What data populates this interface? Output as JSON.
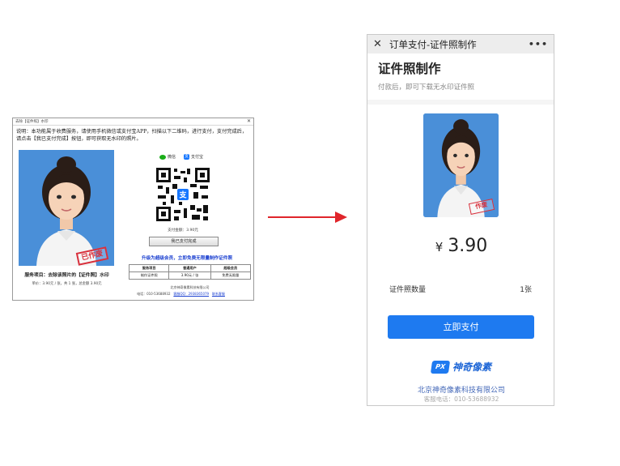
{
  "desktop_window": {
    "title": "去除【证件照】水印",
    "description": "说明：本功能属于收费服务，请使用手机微信或支付宝APP，扫描以下二维码，进行支付，支付完成后，请点击【我已支付完成】按钮，即可获取无水印的照片。",
    "stamp_text": "已作废",
    "service_item": "服务项目：去除该照片的【证件照】水印",
    "unit_line": "单价：3.90元 / 张，共 1 张，总金额 3.90元",
    "wechat_label": "微信",
    "alipay_label": "支付宝",
    "pay_total": "支付金额：3.90元",
    "paid_button": "我已支付完成",
    "vip_promo": "升级为超级会员，立即免费无限量制作证件照",
    "table": {
      "headers": [
        "服务项目",
        "普通用户",
        "超级会员"
      ],
      "rows": [
        [
          "制作证件照",
          "3.90元 / 张",
          "免费无限量"
        ]
      ]
    },
    "company": "北京神奇像素科技有限公司",
    "phone_line": "电话：010-53688932",
    "qq_line": "客服QQ：2938365079",
    "contact_link": "联系客服"
  },
  "mobile": {
    "header_title": "订单支付-证件照制作",
    "more_icon": "•••",
    "page_title": "证件照制作",
    "subtitle": "付款后，即可下载无水印证件照",
    "stamp_text": "作废",
    "currency": "¥",
    "price": "3.90",
    "quantity_label": "证件照数量",
    "quantity_value": "1张",
    "pay_button": "立即支付",
    "brand_badge": "PX",
    "brand_name": "神奇像素",
    "company": "北京神奇像素科技有限公司",
    "support_phone": "客服电话：010-53688932"
  },
  "colors": {
    "accent": "#1e7af0",
    "photo_bg": "#4a8fd8",
    "stamp": "#d8303c",
    "arrow": "#e0252b",
    "wechat": "#1aad19",
    "alipay": "#1677ff"
  }
}
